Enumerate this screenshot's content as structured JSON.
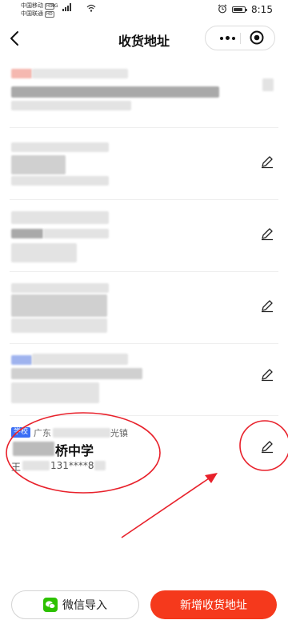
{
  "status_bar": {
    "carrier1": "中国移动",
    "carrier2": "中国联通",
    "hd": "HD",
    "network": "4G",
    "time": "8:15"
  },
  "nav": {
    "title": "收货地址"
  },
  "addresses": [
    {
      "editable": false
    },
    {
      "editable": true
    },
    {
      "editable": true
    },
    {
      "editable": true
    },
    {
      "editable": true
    },
    {
      "editable": true,
      "tag": "学校",
      "region_prefix": "广东",
      "region_suffix": "光镇",
      "school": "桥中学",
      "contact_name": "王",
      "phone": "131****8"
    }
  ],
  "buttons": {
    "wechat_import": "微信导入",
    "add_address": "新增收货地址"
  },
  "colors": {
    "accent": "#f5391c",
    "wechat": "#2dc100",
    "tag": "#3b6ef5",
    "annotation": "#e8212b"
  },
  "icons": [
    "back-icon",
    "more-icon",
    "target-icon",
    "edit-icon",
    "wechat-icon",
    "alarm-icon",
    "battery-icon",
    "wifi-icon"
  ]
}
